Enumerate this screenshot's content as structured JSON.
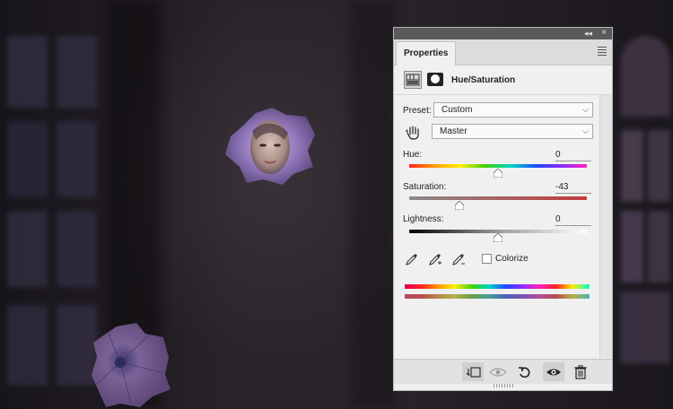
{
  "panel": {
    "title_tab": "Properties",
    "collapse_glyph": "◂◂",
    "close_glyph": "×",
    "adjustment_title": "Hue/Saturation",
    "preset": {
      "label": "Preset:",
      "value": "Custom"
    },
    "channel": {
      "value": "Master"
    },
    "hue": {
      "label": "Hue:",
      "value": "0",
      "slider_fraction": 0.5
    },
    "saturation": {
      "label": "Saturation:",
      "value": "-43",
      "slider_fraction": 0.285
    },
    "lightness": {
      "label": "Lightness:",
      "value": "0",
      "slider_fraction": 0.5
    },
    "colorize": {
      "label": "Colorize",
      "checked": false
    },
    "bottom_buttons": [
      "clip-to-layer",
      "view-previous-state",
      "reset",
      "toggle-visibility",
      "delete"
    ]
  },
  "colors": {
    "panel_bg": "#f0f0f0",
    "dark_strip": "#5a5a5a",
    "flower_purple": "#8a6fb0"
  },
  "icons": {
    "targeted_adjustment": "hand-icon",
    "eyedroppers": [
      "eyedropper-icon",
      "eyedropper-plus-icon",
      "eyedropper-minus-icon"
    ]
  }
}
